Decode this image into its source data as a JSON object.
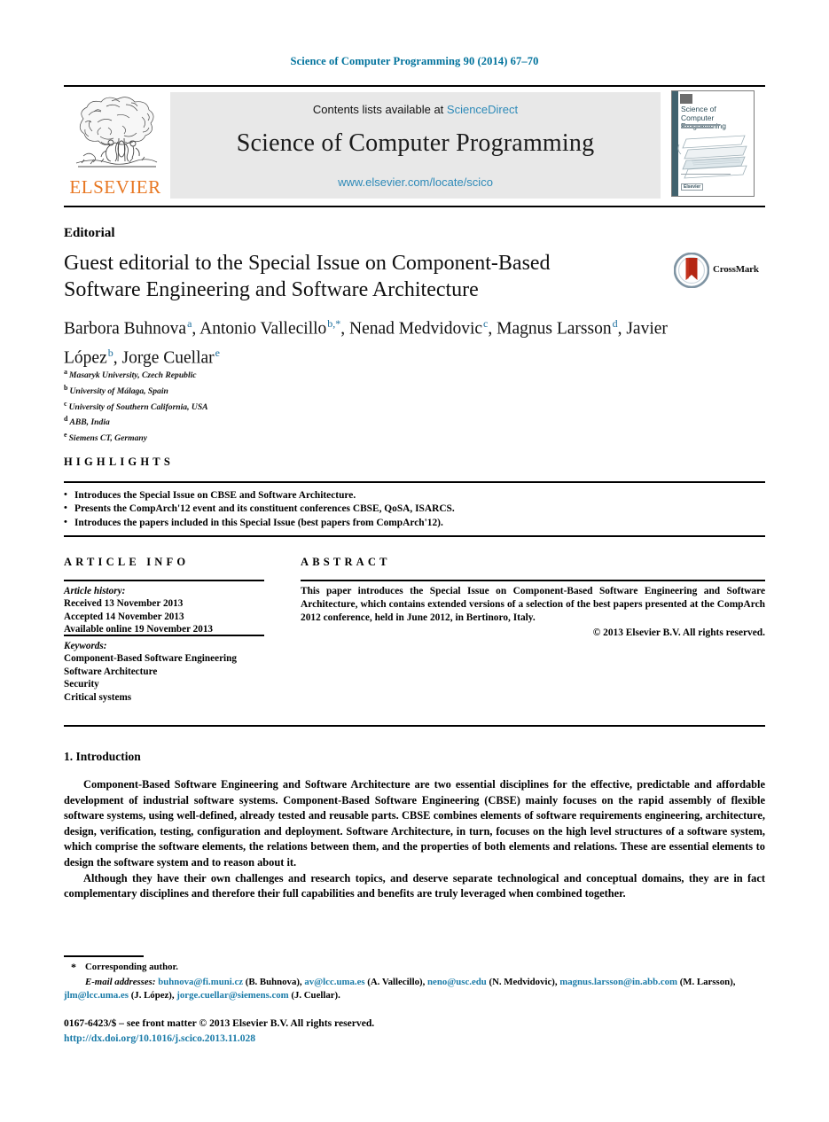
{
  "running_head": "Science of Computer Programming 90 (2014) 67–70",
  "masthead": {
    "publisher_wordmark": "ELSEVIER",
    "contents_line_prefix": "Contents lists available at ",
    "contents_link": "ScienceDirect",
    "journal_title": "Science of Computer Programming",
    "journal_url": "www.elsevier.com/locate/scico",
    "cover": {
      "title": "Science of Computer Programming",
      "footer_badge": "Elsevier"
    }
  },
  "article": {
    "type": "Editorial",
    "title": "Guest editorial to the Special Issue on Component-Based Software Engineering and Software Architecture",
    "crossmark_label": "CrossMark",
    "authors": [
      {
        "name": "Barbora Buhnova",
        "marks": "a",
        "sep": ", "
      },
      {
        "name": "Antonio Vallecillo",
        "marks": "b,*",
        "sep": ", "
      },
      {
        "name": "Nenad Medvidovic",
        "marks": "c",
        "sep": ", "
      },
      {
        "name": "Magnus Larsson",
        "marks": "d",
        "sep": ", "
      },
      {
        "name": "Javier López",
        "marks": "b",
        "sep": ", "
      },
      {
        "name": "Jorge Cuellar",
        "marks": "e",
        "sep": ""
      }
    ],
    "affiliations": [
      {
        "mark": "a",
        "text": "Masaryk University, Czech Republic"
      },
      {
        "mark": "b",
        "text": "University of Málaga, Spain"
      },
      {
        "mark": "c",
        "text": "University of Southern California, USA"
      },
      {
        "mark": "d",
        "text": "ABB, India"
      },
      {
        "mark": "e",
        "text": "Siemens CT, Germany"
      }
    ]
  },
  "highlights": {
    "heading": "HIGHLIGHTS",
    "items": [
      "Introduces the Special Issue on CBSE and Software Architecture.",
      "Presents the CompArch'12 event and its constituent conferences CBSE, QoSA, ISARCS.",
      "Introduces the papers included in this Special Issue (best papers from CompArch'12)."
    ]
  },
  "article_info": {
    "heading": "ARTICLE INFO",
    "history_label": "Article history:",
    "history": [
      "Received 13 November 2013",
      "Accepted 14 November 2013",
      "Available online 19 November 2013"
    ],
    "keywords_label": "Keywords:",
    "keywords": [
      "Component-Based Software Engineering",
      "Software Architecture",
      "Security",
      "Critical systems"
    ]
  },
  "abstract": {
    "heading": "ABSTRACT",
    "text": "This paper introduces the Special Issue on Component-Based Software Engineering and Software Architecture, which contains extended versions of a selection of the best papers presented at the CompArch 2012 conference, held in June 2012, in Bertinoro, Italy.",
    "copyright": "© 2013 Elsevier B.V. All rights reserved."
  },
  "body": {
    "section_number_title": "1. Introduction",
    "paragraphs": [
      "Component-Based Software Engineering and Software Architecture are two essential disciplines for the effective, predictable and affordable development of industrial software systems. Component-Based Software Engineering (CBSE) mainly focuses on the rapid assembly of flexible software systems, using well-defined, already tested and reusable parts. CBSE combines elements of software requirements engineering, architecture, design, verification, testing, configuration and deployment. Software Architecture, in turn, focuses on the high level structures of a software system, which comprise the software elements, the relations between them, and the properties of both elements and relations. These are essential elements to design the software system and to reason about it.",
      "Although they have their own challenges and research topics, and deserve separate technological and conceptual domains, they are in fact complementary disciplines and therefore their full capabilities and benefits are truly leveraged when combined together."
    ]
  },
  "footnotes": {
    "corresponding_author": "Corresponding author.",
    "email_label": "E-mail addresses:",
    "emails": [
      {
        "address": "buhnova@fi.muni.cz",
        "owner": "(B. Buhnova)",
        "sep": ", "
      },
      {
        "address": "av@lcc.uma.es",
        "owner": "(A. Vallecillo)",
        "sep": ", "
      },
      {
        "address": "neno@usc.edu",
        "owner": "(N. Medvidovic)",
        "sep": ", "
      },
      {
        "address": "magnus.larsson@in.abb.com",
        "owner": "(M. Larsson)",
        "sep": ", "
      },
      {
        "address": "jlm@lcc.uma.es",
        "owner": "(J. López)",
        "sep": ", "
      },
      {
        "address": "jorge.cuellar@siemens.com",
        "owner": "(J. Cuellar)",
        "sep": "."
      }
    ],
    "issn_line": "0167-6423/$ – see front matter © 2013 Elsevier B.V. All rights reserved.",
    "doi": "http://dx.doi.org/10.1016/j.scico.2013.11.028"
  },
  "colors": {
    "link_blue": "#1a7ba8",
    "sciencedirect_blue": "#2e8ab8",
    "elsevier_orange": "#e87722",
    "banner_gray": "#e8e8e8",
    "crossmark_red": "#b52714"
  }
}
